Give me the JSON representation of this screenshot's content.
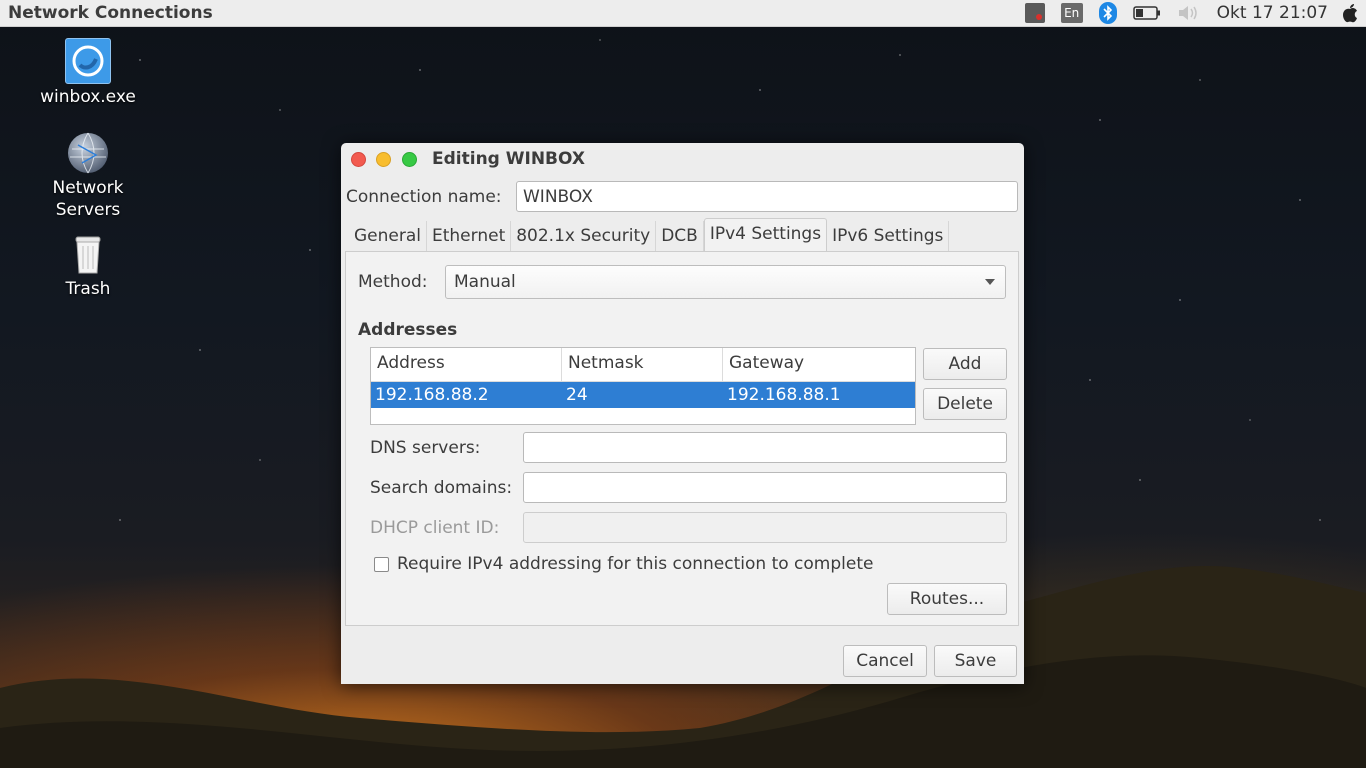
{
  "top_panel": {
    "app_title": "Network Connections",
    "keyboard_layout": "En",
    "clock": "Okt 17 21:07"
  },
  "desktop": {
    "icons": [
      {
        "label": "winbox.exe"
      },
      {
        "label": "Network Servers"
      },
      {
        "label": "Trash"
      }
    ]
  },
  "dialog": {
    "title": "Editing WINBOX",
    "connection_name_label": "Connection name:",
    "connection_name_value": "WINBOX",
    "tabs": [
      {
        "label": "General"
      },
      {
        "label": "Ethernet"
      },
      {
        "label": "802.1x Security"
      },
      {
        "label": "DCB"
      },
      {
        "label": "IPv4 Settings",
        "active": true
      },
      {
        "label": "IPv6 Settings"
      }
    ],
    "method_label": "Method:",
    "method_value": "Manual",
    "addresses_title": "Addresses",
    "addresses_columns": [
      "Address",
      "Netmask",
      "Gateway"
    ],
    "addresses_rows": [
      {
        "address": "192.168.88.2",
        "netmask": "24",
        "gateway": "192.168.88.1"
      }
    ],
    "add_label": "Add",
    "delete_label": "Delete",
    "dns_label": "DNS servers:",
    "dns_value": "",
    "search_domains_label": "Search domains:",
    "search_domains_value": "",
    "dhcp_client_id_label": "DHCP client ID:",
    "dhcp_client_id_value": "",
    "require_ipv4_label": "Require IPv4 addressing for this connection to complete",
    "require_ipv4_checked": false,
    "routes_label": "Routes...",
    "cancel_label": "Cancel",
    "save_label": "Save"
  },
  "colors": {
    "selection": "#2e7ed3",
    "close_button": "#f25a4f",
    "minimize_button": "#f8bd2e",
    "maximize_button": "#37c944"
  }
}
